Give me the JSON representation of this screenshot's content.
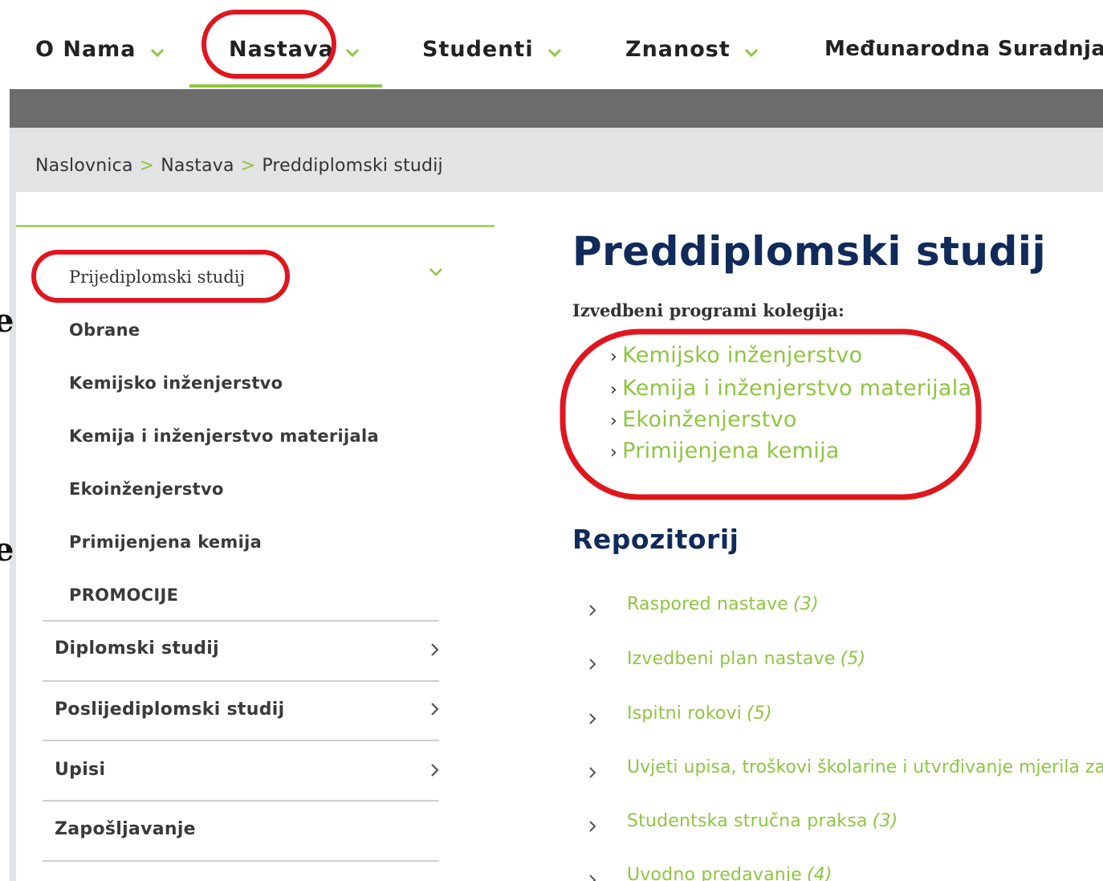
{
  "topnav": {
    "items": [
      {
        "label": "O Nama"
      },
      {
        "label": "Nastava"
      },
      {
        "label": "Studenti"
      },
      {
        "label": "Znanost"
      },
      {
        "label": "Međunarodna Suradnja"
      }
    ]
  },
  "breadcrumb": {
    "items": [
      "Naslovnica",
      "Nastava",
      "Preddiplomski studij"
    ],
    "separator": ">"
  },
  "sidebar": {
    "first_sub": "Prijediplomski studij",
    "sub_items": [
      "Obrane",
      "Kemijsko inženjerstvo",
      "Kemija i inženjerstvo materijala",
      "Ekoinženjerstvo",
      "Primijenjena kemija",
      "PROMOCIJE"
    ],
    "main_items": [
      "Diplomski studij",
      "Poslijediplomski studij",
      "Upisi",
      "Zapošljavanje"
    ],
    "edge_chars": [
      "e",
      "e"
    ]
  },
  "main": {
    "title": "Preddiplomski studij",
    "intro": "Izvedbeni programi kolegija:",
    "program_links": [
      "Kemijsko inženjerstvo",
      "Kemija i inženjerstvo materijala",
      "Ekoinženjerstvo",
      "Primijenjena kemija"
    ],
    "repo_title": "Repozitorij",
    "repo_items": [
      {
        "label": "Raspored nastave",
        "count": "(3)"
      },
      {
        "label": "Izvedbeni plan nastave",
        "count": "(5)"
      },
      {
        "label": "Ispitni rokovi",
        "count": "(5)"
      },
      {
        "label": "Uvjeti upisa, troškovi školarine i utvrđivanje mjerila za",
        "count": ""
      },
      {
        "label": "Studentska stručna praksa",
        "count": "(3)"
      },
      {
        "label": "Uvodno predavanje",
        "count": "(4)"
      }
    ]
  },
  "colors": {
    "accent_green": "#8dc63f",
    "title_navy": "#102a5a",
    "grey_bar": "#6c6c6c",
    "breadcrumb_band": "#e2e3e4",
    "annotation_red": "#e0161e"
  },
  "icons": {
    "nav_dropdown": "chevron-down-icon",
    "sidebar_expand": "chevron-down-icon",
    "sidebar_arrow": "chevron-right-icon",
    "repo_bullet": "chevron-right-icon"
  }
}
